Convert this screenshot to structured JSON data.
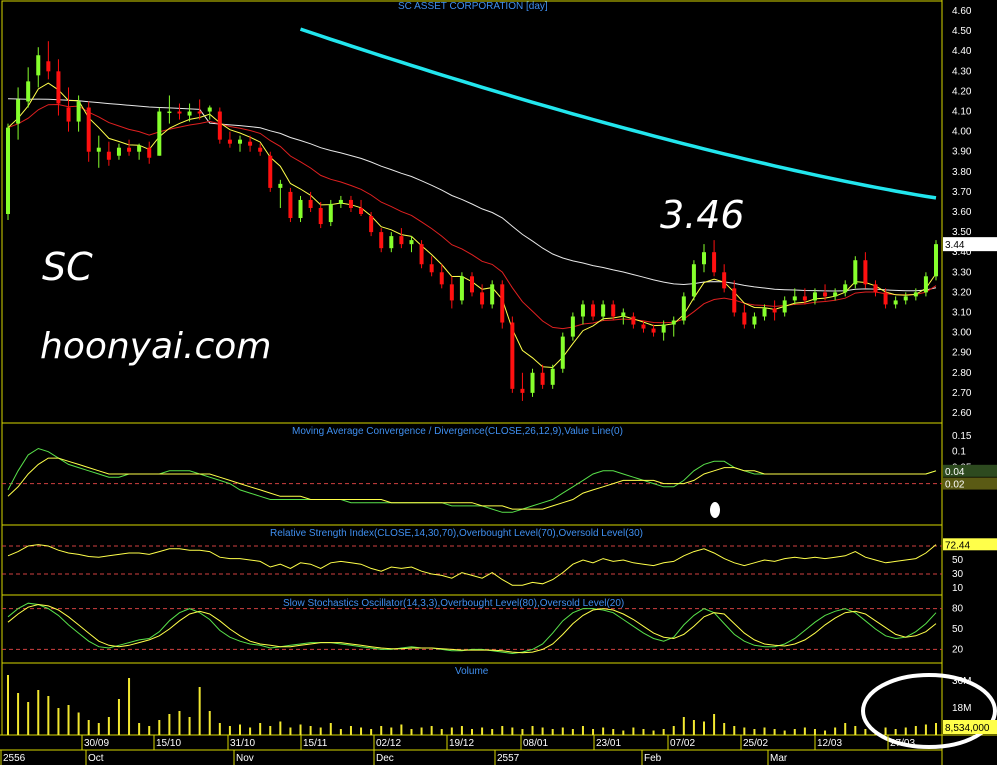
{
  "chart_data": {
    "type": "candlestick",
    "title": "SC ASSET CORPORATION [day]",
    "annotations": {
      "ticker": "SC",
      "website": "hoonyai.com",
      "price_callout": "3.46"
    },
    "colors": {
      "up": "#86ff2c",
      "down": "#ff1010",
      "ma200": "#22e6ee",
      "ma_white": "#e8e8e8",
      "ma_red": "#e02020",
      "ma_yellow": "#ffff4a",
      "panel_border": "#d6d600",
      "ref_line": "#d04040",
      "axis_text": "#ffffff",
      "title_text": "#3f8ff0"
    },
    "price_panel": {
      "ylim": [
        2.55,
        4.65
      ],
      "yticks": [
        "4.60",
        "4.50",
        "4.40",
        "4.30",
        "4.20",
        "4.10",
        "4.00",
        "3.90",
        "3.80",
        "3.70",
        "3.60",
        "3.50",
        "3.40",
        "3.30",
        "3.20",
        "3.10",
        "3.00",
        "2.90",
        "2.80",
        "2.70",
        "2.60"
      ],
      "last_price_label": "3.44",
      "ma_long_endpoints": [
        4.51,
        3.67
      ]
    },
    "macd_panel": {
      "title": "Moving Average Convergence / Divergence(CLOSE,26,12,9),Value Line(0)",
      "yticks": [
        "0.15",
        "0.1",
        "0.05"
      ],
      "value_labels": [
        "0.04",
        "0.02"
      ]
    },
    "rsi_panel": {
      "title": "Relative Strength Index(CLOSE,14,30,70),Overbought Level(70),Oversold Level(30)",
      "yticks": [
        "70",
        "50",
        "30",
        "10"
      ],
      "levels": [
        70,
        30
      ],
      "last_label": "72.44"
    },
    "stoch_panel": {
      "title": "Slow Stochastics Oscillator(14,3,3),Overbought Level(80),Oversold Level(20)",
      "yticks": [
        "80",
        "50",
        "20"
      ],
      "levels": [
        80,
        20
      ]
    },
    "volume_panel": {
      "title": "Volume",
      "yticks": [
        "36M",
        "18M"
      ],
      "last_label": "8,534,000"
    },
    "x_axis": {
      "upper_ticks": [
        "30/09",
        "15/10",
        "31/10",
        "15/11",
        "02/12",
        "19/12",
        "08/01",
        "23/01",
        "07/02",
        "25/02",
        "12/03",
        "27/03"
      ],
      "lower_ticks": [
        "2556",
        "Oct",
        "Nov",
        "Dec",
        "2557",
        "Feb",
        "Mar"
      ]
    },
    "candles": [
      [
        3.59,
        4.04,
        3.56,
        4.02
      ],
      [
        4.04,
        4.22,
        3.96,
        4.16
      ],
      [
        4.15,
        4.32,
        4.12,
        4.25
      ],
      [
        4.28,
        4.42,
        4.22,
        4.38
      ],
      [
        4.35,
        4.45,
        4.26,
        4.3
      ],
      [
        4.3,
        4.36,
        4.08,
        4.14
      ],
      [
        4.12,
        4.22,
        4.0,
        4.05
      ],
      [
        4.05,
        4.18,
        4.0,
        4.15
      ],
      [
        4.12,
        4.15,
        3.85,
        3.9
      ],
      [
        3.9,
        3.98,
        3.82,
        3.92
      ],
      [
        3.9,
        3.95,
        3.83,
        3.86
      ],
      [
        3.88,
        3.94,
        3.86,
        3.92
      ],
      [
        3.92,
        3.96,
        3.88,
        3.9
      ],
      [
        3.9,
        3.94,
        3.86,
        3.93
      ],
      [
        3.92,
        3.95,
        3.84,
        3.87
      ],
      [
        3.88,
        4.12,
        3.88,
        4.1
      ],
      [
        4.1,
        4.18,
        4.04,
        4.1
      ],
      [
        4.1,
        4.14,
        4.06,
        4.09
      ],
      [
        4.08,
        4.14,
        4.05,
        4.1
      ],
      [
        4.1,
        4.16,
        4.06,
        4.09
      ],
      [
        4.1,
        4.13,
        4.06,
        4.12
      ],
      [
        4.1,
        4.12,
        3.94,
        3.96
      ],
      [
        3.96,
        4.0,
        3.92,
        3.94
      ],
      [
        3.94,
        3.98,
        3.9,
        3.96
      ],
      [
        3.95,
        3.98,
        3.9,
        3.93
      ],
      [
        3.92,
        3.94,
        3.88,
        3.9
      ],
      [
        3.88,
        3.9,
        3.7,
        3.72
      ],
      [
        3.72,
        3.76,
        3.62,
        3.74
      ],
      [
        3.7,
        3.72,
        3.55,
        3.57
      ],
      [
        3.57,
        3.68,
        3.55,
        3.66
      ],
      [
        3.66,
        3.7,
        3.6,
        3.62
      ],
      [
        3.62,
        3.65,
        3.52,
        3.54
      ],
      [
        3.55,
        3.66,
        3.53,
        3.64
      ],
      [
        3.64,
        3.68,
        3.62,
        3.66
      ],
      [
        3.66,
        3.68,
        3.6,
        3.62
      ],
      [
        3.62,
        3.66,
        3.58,
        3.59
      ],
      [
        3.58,
        3.6,
        3.48,
        3.5
      ],
      [
        3.5,
        3.52,
        3.4,
        3.42
      ],
      [
        3.42,
        3.5,
        3.4,
        3.48
      ],
      [
        3.48,
        3.52,
        3.42,
        3.44
      ],
      [
        3.44,
        3.48,
        3.4,
        3.46
      ],
      [
        3.44,
        3.46,
        3.32,
        3.34
      ],
      [
        3.34,
        3.38,
        3.28,
        3.3
      ],
      [
        3.3,
        3.34,
        3.22,
        3.24
      ],
      [
        3.24,
        3.28,
        3.12,
        3.16
      ],
      [
        3.16,
        3.3,
        3.14,
        3.28
      ],
      [
        3.28,
        3.3,
        3.18,
        3.2
      ],
      [
        3.2,
        3.24,
        3.12,
        3.14
      ],
      [
        3.14,
        3.26,
        3.12,
        3.24
      ],
      [
        3.24,
        3.26,
        3.02,
        3.05
      ],
      [
        3.05,
        3.08,
        2.7,
        2.72
      ],
      [
        2.72,
        2.8,
        2.66,
        2.7
      ],
      [
        2.7,
        2.82,
        2.68,
        2.8
      ],
      [
        2.8,
        2.84,
        2.72,
        2.74
      ],
      [
        2.74,
        2.84,
        2.72,
        2.82
      ],
      [
        2.82,
        3.0,
        2.8,
        2.98
      ],
      [
        2.98,
        3.1,
        2.96,
        3.08
      ],
      [
        3.08,
        3.16,
        3.04,
        3.14
      ],
      [
        3.14,
        3.16,
        3.06,
        3.08
      ],
      [
        3.08,
        3.16,
        3.06,
        3.14
      ],
      [
        3.14,
        3.16,
        3.06,
        3.08
      ],
      [
        3.08,
        3.12,
        3.04,
        3.1
      ],
      [
        3.08,
        3.1,
        3.02,
        3.04
      ],
      [
        3.04,
        3.06,
        3.0,
        3.02
      ],
      [
        3.02,
        3.04,
        2.98,
        3.0
      ],
      [
        3.0,
        3.06,
        2.96,
        3.04
      ],
      [
        3.04,
        3.08,
        2.98,
        3.06
      ],
      [
        3.06,
        3.2,
        3.04,
        3.18
      ],
      [
        3.18,
        3.36,
        3.16,
        3.34
      ],
      [
        3.34,
        3.44,
        3.3,
        3.4
      ],
      [
        3.4,
        3.46,
        3.28,
        3.3
      ],
      [
        3.3,
        3.34,
        3.2,
        3.22
      ],
      [
        3.22,
        3.26,
        3.08,
        3.1
      ],
      [
        3.1,
        3.14,
        3.02,
        3.04
      ],
      [
        3.04,
        3.1,
        3.02,
        3.08
      ],
      [
        3.08,
        3.14,
        3.06,
        3.12
      ],
      [
        3.12,
        3.16,
        3.06,
        3.1
      ],
      [
        3.1,
        3.18,
        3.08,
        3.16
      ],
      [
        3.16,
        3.22,
        3.14,
        3.18
      ],
      [
        3.18,
        3.22,
        3.14,
        3.16
      ],
      [
        3.16,
        3.22,
        3.14,
        3.2
      ],
      [
        3.2,
        3.24,
        3.16,
        3.18
      ],
      [
        3.18,
        3.22,
        3.16,
        3.2
      ],
      [
        3.2,
        3.26,
        3.18,
        3.24
      ],
      [
        3.24,
        3.38,
        3.22,
        3.36
      ],
      [
        3.36,
        3.4,
        3.22,
        3.24
      ],
      [
        3.24,
        3.26,
        3.18,
        3.2
      ],
      [
        3.2,
        3.22,
        3.12,
        3.14
      ],
      [
        3.14,
        3.18,
        3.12,
        3.16
      ],
      [
        3.16,
        3.2,
        3.14,
        3.18
      ],
      [
        3.18,
        3.22,
        3.16,
        3.2
      ],
      [
        3.2,
        3.3,
        3.18,
        3.28
      ],
      [
        3.28,
        3.46,
        3.26,
        3.44
      ]
    ],
    "volume_m": [
      40,
      28,
      22,
      30,
      26,
      18,
      20,
      15,
      10,
      8,
      12,
      24,
      38,
      8,
      6,
      10,
      14,
      16,
      12,
      32,
      16,
      8,
      6,
      7,
      5,
      8,
      6,
      9,
      5,
      7,
      6,
      5,
      8,
      4,
      6,
      5,
      4,
      6,
      5,
      7,
      4,
      5,
      6,
      4,
      5,
      6,
      4,
      5,
      4,
      6,
      5,
      4,
      6,
      5,
      4,
      5,
      4,
      6,
      4,
      5,
      4,
      3,
      5,
      4,
      3,
      4,
      6,
      12,
      10,
      9,
      14,
      8,
      6,
      5,
      4,
      5,
      4,
      3,
      4,
      5,
      4,
      3,
      5,
      8,
      6,
      4,
      3,
      5,
      4,
      5,
      6,
      7,
      8
    ],
    "macd_line": [
      -0.02,
      0.04,
      0.09,
      0.11,
      0.1,
      0.08,
      0.06,
      0.05,
      0.04,
      0.03,
      0.02,
      0.02,
      0.03,
      0.03,
      0.03,
      0.03,
      0.04,
      0.04,
      0.04,
      0.03,
      0.02,
      0.01,
      0.0,
      -0.02,
      -0.03,
      -0.04,
      -0.05,
      -0.05,
      -0.05,
      -0.05,
      -0.05,
      -0.05,
      -0.05,
      -0.05,
      -0.06,
      -0.06,
      -0.06,
      -0.06,
      -0.06,
      -0.06,
      -0.06,
      -0.06,
      -0.06,
      -0.06,
      -0.07,
      -0.07,
      -0.07,
      -0.07,
      -0.08,
      -0.09,
      -0.09,
      -0.08,
      -0.07,
      -0.06,
      -0.05,
      -0.03,
      -0.01,
      0.01,
      0.03,
      0.04,
      0.04,
      0.03,
      0.02,
      0.01,
      0.0,
      -0.01,
      -0.01,
      0.01,
      0.04,
      0.06,
      0.07,
      0.07,
      0.05,
      0.04,
      0.03,
      0.03,
      0.03,
      0.03,
      0.03,
      0.03,
      0.03,
      0.03,
      0.03,
      0.03,
      0.03,
      0.03,
      0.03,
      0.03,
      0.03,
      0.03,
      0.03,
      0.03,
      0.04
    ],
    "macd_signal": [
      -0.04,
      -0.01,
      0.03,
      0.06,
      0.08,
      0.08,
      0.07,
      0.06,
      0.05,
      0.04,
      0.03,
      0.03,
      0.03,
      0.03,
      0.03,
      0.03,
      0.03,
      0.03,
      0.03,
      0.03,
      0.03,
      0.02,
      0.01,
      0.0,
      -0.01,
      -0.02,
      -0.03,
      -0.04,
      -0.04,
      -0.04,
      -0.05,
      -0.05,
      -0.05,
      -0.05,
      -0.05,
      -0.05,
      -0.05,
      -0.05,
      -0.06,
      -0.06,
      -0.06,
      -0.06,
      -0.06,
      -0.06,
      -0.06,
      -0.06,
      -0.06,
      -0.07,
      -0.07,
      -0.07,
      -0.08,
      -0.08,
      -0.08,
      -0.08,
      -0.07,
      -0.06,
      -0.05,
      -0.03,
      -0.02,
      -0.01,
      0.0,
      0.01,
      0.01,
      0.01,
      0.01,
      0.0,
      0.0,
      0.0,
      0.01,
      0.03,
      0.04,
      0.05,
      0.05,
      0.04,
      0.04,
      0.03,
      0.03,
      0.03,
      0.03,
      0.03,
      0.03,
      0.03,
      0.03,
      0.03,
      0.03,
      0.03,
      0.03,
      0.03,
      0.03,
      0.03,
      0.03,
      0.03,
      0.04
    ],
    "rsi": [
      56,
      62,
      70,
      72,
      70,
      64,
      60,
      58,
      55,
      54,
      56,
      58,
      60,
      60,
      58,
      62,
      66,
      66,
      64,
      64,
      62,
      54,
      52,
      52,
      50,
      48,
      40,
      44,
      38,
      46,
      44,
      38,
      46,
      48,
      46,
      44,
      38,
      34,
      40,
      38,
      40,
      34,
      30,
      28,
      24,
      32,
      28,
      24,
      32,
      22,
      14,
      14,
      18,
      16,
      22,
      32,
      44,
      50,
      46,
      52,
      48,
      50,
      46,
      44,
      42,
      46,
      48,
      56,
      62,
      66,
      60,
      52,
      46,
      42,
      46,
      50,
      48,
      52,
      54,
      52,
      54,
      52,
      54,
      56,
      62,
      54,
      50,
      46,
      48,
      50,
      52,
      60,
      72
    ],
    "stoch_k": [
      68,
      80,
      88,
      86,
      80,
      70,
      56,
      44,
      32,
      24,
      22,
      26,
      30,
      34,
      36,
      46,
      62,
      74,
      80,
      74,
      64,
      48,
      38,
      32,
      28,
      26,
      22,
      24,
      26,
      28,
      30,
      30,
      30,
      28,
      26,
      24,
      22,
      20,
      20,
      22,
      24,
      22,
      22,
      20,
      18,
      18,
      20,
      20,
      18,
      16,
      14,
      16,
      20,
      28,
      44,
      62,
      74,
      80,
      80,
      78,
      74,
      64,
      54,
      44,
      36,
      32,
      38,
      56,
      70,
      80,
      74,
      58,
      42,
      32,
      26,
      24,
      24,
      28,
      36,
      48,
      60,
      70,
      76,
      80,
      74,
      62,
      50,
      40,
      36,
      38,
      46,
      58,
      74
    ],
    "stoch_d": [
      60,
      72,
      82,
      86,
      84,
      78,
      68,
      56,
      44,
      32,
      26,
      24,
      26,
      30,
      34,
      40,
      50,
      62,
      72,
      76,
      72,
      62,
      50,
      40,
      32,
      28,
      26,
      24,
      24,
      26,
      28,
      30,
      30,
      30,
      28,
      26,
      24,
      22,
      21,
      21,
      22,
      22,
      22,
      21,
      20,
      19,
      19,
      19,
      19,
      18,
      16,
      15,
      16,
      20,
      28,
      42,
      58,
      70,
      78,
      80,
      78,
      72,
      64,
      54,
      44,
      38,
      36,
      42,
      54,
      68,
      74,
      72,
      58,
      44,
      34,
      28,
      26,
      25,
      28,
      34,
      44,
      56,
      66,
      74,
      76,
      72,
      62,
      52,
      42,
      38,
      40,
      46,
      58
    ]
  }
}
